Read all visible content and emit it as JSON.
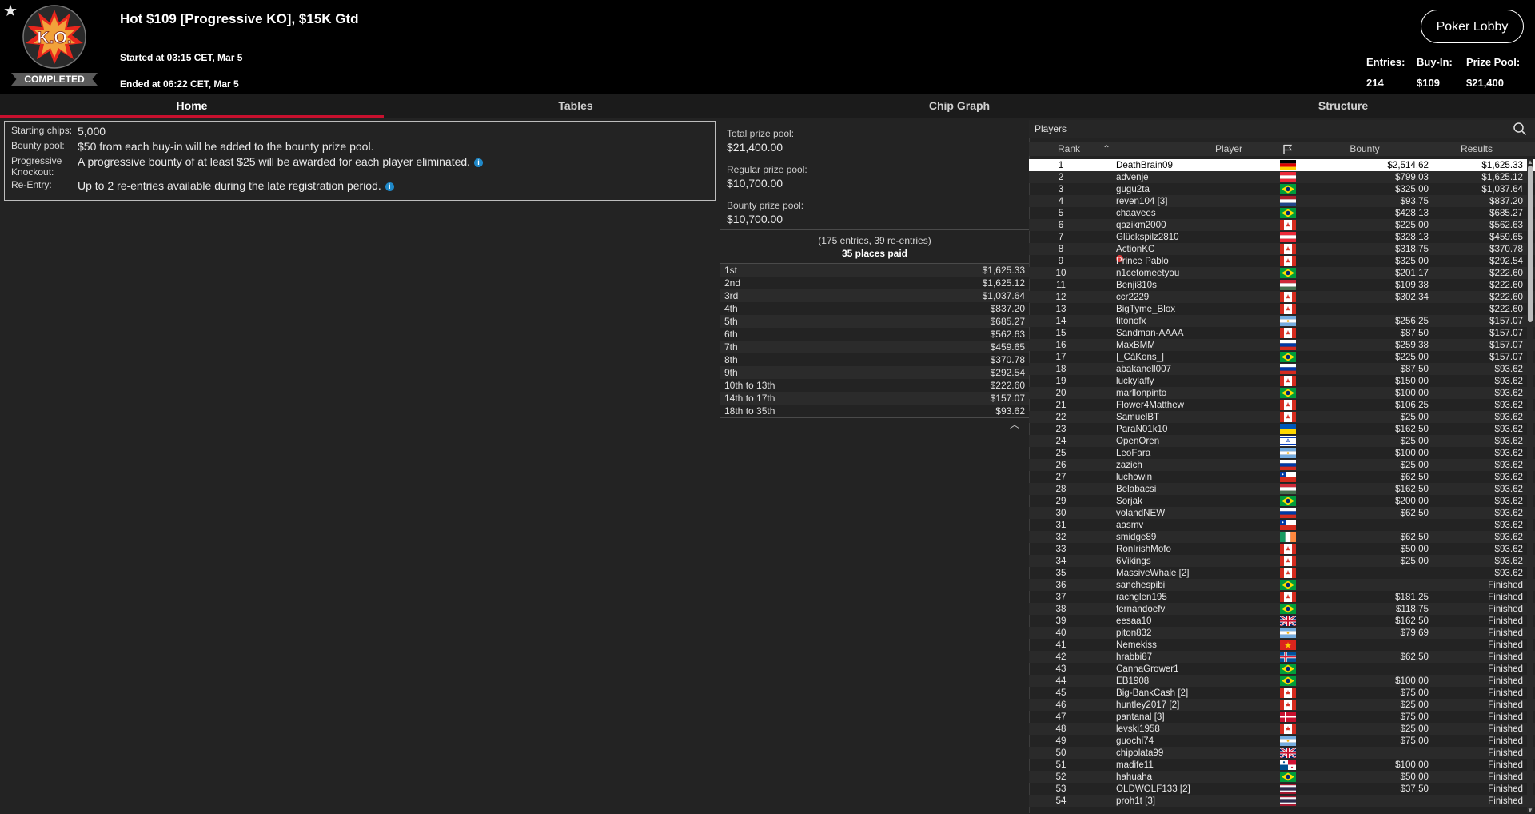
{
  "header": {
    "status_ribbon": "COMPLETED",
    "logo_text": "K.O.",
    "title": "Hot $109 [Progressive KO], $15K Gtd",
    "started": "Started at 03:15 CET, Mar 5",
    "ended": "Ended at 06:22 CET, Mar 5",
    "lobby_button": "Poker Lobby",
    "stats": [
      {
        "label": "Entries:",
        "value": "214"
      },
      {
        "label": "Buy-In:",
        "value": "$109"
      },
      {
        "label": "Prize Pool:",
        "value": "$21,400"
      }
    ]
  },
  "tabs": [
    {
      "label": "Home",
      "active": true
    },
    {
      "label": "Tables"
    },
    {
      "label": "Chip Graph"
    },
    {
      "label": "Structure"
    }
  ],
  "info": [
    {
      "label": "Starting chips:",
      "value": "5,000"
    },
    {
      "label": "Bounty pool:",
      "value": "$50 from each buy-in will be added to the bounty prize pool."
    },
    {
      "label": "Progressive Knockout:",
      "value": "A progressive bounty of at least $25 will be awarded for each player eliminated."
    },
    {
      "label": "Re-Entry:",
      "value": "Up to 2 re-entries available during the late registration period."
    }
  ],
  "prize": {
    "total_label": "Total prize pool:",
    "total_value": "$21,400.00",
    "regular_label": "Regular prize pool:",
    "regular_value": "$10,700.00",
    "bounty_label": "Bounty prize pool:",
    "bounty_value": "$10,700.00",
    "entries_note": "(175 entries, 39 re-entries)",
    "places_paid": "35 places paid",
    "payouts": [
      {
        "place": "1st",
        "amount": "$1,625.33"
      },
      {
        "place": "2nd",
        "amount": "$1,625.12"
      },
      {
        "place": "3rd",
        "amount": "$1,037.64"
      },
      {
        "place": "4th",
        "amount": "$837.20"
      },
      {
        "place": "5th",
        "amount": "$685.27"
      },
      {
        "place": "6th",
        "amount": "$562.63"
      },
      {
        "place": "7th",
        "amount": "$459.65"
      },
      {
        "place": "8th",
        "amount": "$370.78"
      },
      {
        "place": "9th",
        "amount": "$292.54"
      },
      {
        "place": "10th to 13th",
        "amount": "$222.60"
      },
      {
        "place": "14th to 17th",
        "amount": "$157.07"
      },
      {
        "place": "18th to 35th",
        "amount": "$93.62"
      }
    ]
  },
  "players": {
    "title": "Players",
    "columns": {
      "rank": "Rank",
      "player": "Player",
      "bounty": "Bounty",
      "results": "Results"
    },
    "rows": [
      {
        "rank": "1",
        "name": "DeathBrain09",
        "flag": "de",
        "bounty": "$2,514.62",
        "result": "$1,625.33"
      },
      {
        "rank": "2",
        "name": "advenje",
        "flag": "at",
        "bounty": "$799.03",
        "result": "$1,625.12"
      },
      {
        "rank": "3",
        "name": "gugu2ta",
        "flag": "br",
        "bounty": "$325.00",
        "result": "$1,037.64"
      },
      {
        "rank": "4",
        "name": "reven104 [3]",
        "flag": "nl",
        "bounty": "$93.75",
        "result": "$837.20"
      },
      {
        "rank": "5",
        "name": "chaavees",
        "flag": "br",
        "bounty": "$428.13",
        "result": "$685.27"
      },
      {
        "rank": "6",
        "name": "qazikm2000",
        "flag": "ca",
        "bounty": "$225.00",
        "result": "$562.63"
      },
      {
        "rank": "7",
        "name": "Glückspilz2810",
        "flag": "at",
        "bounty": "$328.13",
        "result": "$459.65"
      },
      {
        "rank": "8",
        "name": "ActionKC",
        "flag": "ca",
        "bounty": "$318.75",
        "result": "$370.78"
      },
      {
        "rank": "9",
        "name": "Prince Pablo",
        "flag": "ca",
        "ko": true,
        "bounty": "$325.00",
        "result": "$292.54"
      },
      {
        "rank": "10",
        "name": "n1cetomeetyou",
        "flag": "br",
        "bounty": "$201.17",
        "result": "$222.60"
      },
      {
        "rank": "11",
        "name": "Benji810s",
        "flag": "hu",
        "bounty": "$109.38",
        "result": "$222.60"
      },
      {
        "rank": "12",
        "name": "ccr2229",
        "flag": "ca",
        "bounty": "$302.34",
        "result": "$222.60"
      },
      {
        "rank": "13",
        "name": "BigTyme_Blox",
        "flag": "ca",
        "bounty": "",
        "result": "$222.60"
      },
      {
        "rank": "14",
        "name": "titonofx",
        "flag": "ar",
        "bounty": "$256.25",
        "result": "$157.07"
      },
      {
        "rank": "15",
        "name": "Sandman-AAAA",
        "flag": "ca",
        "bounty": "$87.50",
        "result": "$157.07"
      },
      {
        "rank": "16",
        "name": "MaxBMM",
        "flag": "ru",
        "bounty": "$259.38",
        "result": "$157.07"
      },
      {
        "rank": "17",
        "name": "|_CáKons_|",
        "flag": "br",
        "bounty": "$225.00",
        "result": "$157.07"
      },
      {
        "rank": "18",
        "name": "abakanell007",
        "flag": "ru",
        "bounty": "$87.50",
        "result": "$93.62"
      },
      {
        "rank": "19",
        "name": "luckylaffy",
        "flag": "ca",
        "bounty": "$150.00",
        "result": "$93.62"
      },
      {
        "rank": "20",
        "name": "marllonpinto",
        "flag": "br",
        "bounty": "$100.00",
        "result": "$93.62"
      },
      {
        "rank": "21",
        "name": "Flower4Matthew",
        "flag": "ca",
        "bounty": "$106.25",
        "result": "$93.62"
      },
      {
        "rank": "22",
        "name": "SamuelBT",
        "flag": "ca",
        "bounty": "$25.00",
        "result": "$93.62"
      },
      {
        "rank": "23",
        "name": "ParaN01k10",
        "flag": "ua",
        "bounty": "$162.50",
        "result": "$93.62"
      },
      {
        "rank": "24",
        "name": "OpenOren",
        "flag": "il",
        "bounty": "$25.00",
        "result": "$93.62"
      },
      {
        "rank": "25",
        "name": "LeoFara",
        "flag": "ar",
        "bounty": "$100.00",
        "result": "$93.62"
      },
      {
        "rank": "26",
        "name": "zazich",
        "flag": "ru",
        "bounty": "$25.00",
        "result": "$93.62"
      },
      {
        "rank": "27",
        "name": "luchowin",
        "flag": "cl",
        "bounty": "$62.50",
        "result": "$93.62"
      },
      {
        "rank": "28",
        "name": "Belabacsi",
        "flag": "hu",
        "bounty": "$162.50",
        "result": "$93.62"
      },
      {
        "rank": "29",
        "name": "Sorjak",
        "flag": "br",
        "bounty": "$200.00",
        "result": "$93.62"
      },
      {
        "rank": "30",
        "name": "volandNEW",
        "flag": "ru",
        "bounty": "$62.50",
        "result": "$93.62"
      },
      {
        "rank": "31",
        "name": "aasmv",
        "flag": "cl",
        "bounty": "",
        "result": "$93.62"
      },
      {
        "rank": "32",
        "name": "smidge89",
        "flag": "ie",
        "bounty": "$62.50",
        "result": "$93.62"
      },
      {
        "rank": "33",
        "name": "RonIrishMofo",
        "flag": "ca",
        "bounty": "$50.00",
        "result": "$93.62"
      },
      {
        "rank": "34",
        "name": "6Vikings",
        "flag": "ca",
        "bounty": "$25.00",
        "result": "$93.62"
      },
      {
        "rank": "35",
        "name": "MassiveWhale [2]",
        "flag": "ca",
        "bounty": "",
        "result": "$93.62"
      },
      {
        "rank": "36",
        "name": "sanchespibi",
        "flag": "br",
        "bounty": "",
        "result": "Finished"
      },
      {
        "rank": "37",
        "name": "rachglen195",
        "flag": "ca",
        "bounty": "$181.25",
        "result": "Finished"
      },
      {
        "rank": "38",
        "name": "fernandoefv",
        "flag": "br",
        "bounty": "$118.75",
        "result": "Finished"
      },
      {
        "rank": "39",
        "name": "eesaa10",
        "flag": "gb",
        "bounty": "$162.50",
        "result": "Finished"
      },
      {
        "rank": "40",
        "name": "piton832",
        "flag": "ar",
        "bounty": "$79.69",
        "result": "Finished"
      },
      {
        "rank": "41",
        "name": "Nemekiss",
        "flag": "vn",
        "bounty": "",
        "result": "Finished"
      },
      {
        "rank": "42",
        "name": "hrabbi87",
        "flag": "is",
        "bounty": "$62.50",
        "result": "Finished"
      },
      {
        "rank": "43",
        "name": "CannaGrower1",
        "flag": "br",
        "bounty": "",
        "result": "Finished"
      },
      {
        "rank": "44",
        "name": "EB1908",
        "flag": "br",
        "bounty": "$100.00",
        "result": "Finished"
      },
      {
        "rank": "45",
        "name": "Big-BankCash [2]",
        "flag": "ca",
        "bounty": "$75.00",
        "result": "Finished"
      },
      {
        "rank": "46",
        "name": "huntley2017 [2]",
        "flag": "ca",
        "bounty": "$25.00",
        "result": "Finished"
      },
      {
        "rank": "47",
        "name": "pantanal [3]",
        "flag": "dk",
        "bounty": "$75.00",
        "result": "Finished"
      },
      {
        "rank": "48",
        "name": "levski1958",
        "flag": "ca",
        "bounty": "$25.00",
        "result": "Finished"
      },
      {
        "rank": "49",
        "name": "guochi74",
        "flag": "ar",
        "bounty": "$75.00",
        "result": "Finished"
      },
      {
        "rank": "50",
        "name": "chipolata99",
        "flag": "gb",
        "bounty": "",
        "result": "Finished"
      },
      {
        "rank": "51",
        "name": "madife11",
        "flag": "pa",
        "bounty": "$100.00",
        "result": "Finished"
      },
      {
        "rank": "52",
        "name": "hahuaha",
        "flag": "br",
        "bounty": "$50.00",
        "result": "Finished"
      },
      {
        "rank": "53",
        "name": "OLDWOLF133 [2]",
        "flag": "th",
        "bounty": "$37.50",
        "result": "Finished"
      },
      {
        "rank": "54",
        "name": "proh1t [3]",
        "flag": "th",
        "bounty": "",
        "result": "Finished"
      }
    ]
  },
  "colors": {
    "accent_red": "#c8102e",
    "background": "#232323",
    "header": "#000000",
    "info_blue": "#1f88c8"
  },
  "icons": [
    "star-icon",
    "ko-logo",
    "info-icon",
    "sort-up-icon",
    "flag-column-icon",
    "search-icon",
    "collapse-icon"
  ]
}
